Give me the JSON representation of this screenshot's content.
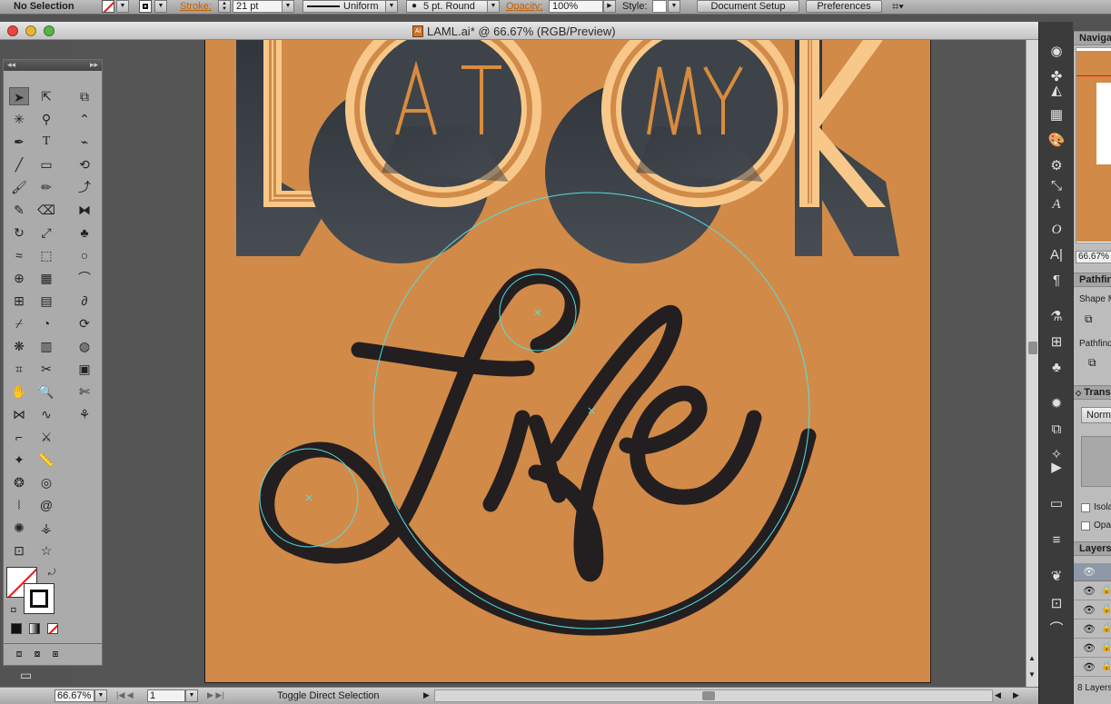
{
  "control_bar": {
    "selection_label": "No Selection",
    "stroke_label": "Stroke:",
    "stroke_weight": "21 pt",
    "profile_label": "Uniform",
    "brush_label": "5 pt. Round",
    "opacity_label": "Opacity:",
    "opacity_value": "100%",
    "style_label": "Style:",
    "document_setup_label": "Document Setup",
    "preferences_label": "Preferences"
  },
  "window": {
    "title": "LAML.ai* @ 66.67% (RGB/Preview)"
  },
  "artwork": {
    "letters": [
      "A",
      "T",
      "M",
      "Y"
    ],
    "background_color": "#d28a48",
    "shadow_color": "#3d4349",
    "line_color": "#f7c88a",
    "script_color": "#231f20",
    "guide_color": "#52e0e0"
  },
  "status_bar": {
    "zoom": "66.67%",
    "artboard_number": "1",
    "tool_status": "Toggle Direct Selection"
  },
  "right_panel": {
    "navigator_tab": "Navigator",
    "nav_zoom": "66.67%",
    "pathfinder_tab": "Pathfinder",
    "shape_modes_label": "Shape Modes:",
    "pathfinders_label": "Pathfinders:",
    "transparency_tab": "Transparency",
    "blend_mode": "Normal",
    "isolate_label": "Isolate Blending",
    "opacity_mask_label": "Opacity Mask",
    "layers_tab": "Layers",
    "layers_count": "8 Layers"
  }
}
